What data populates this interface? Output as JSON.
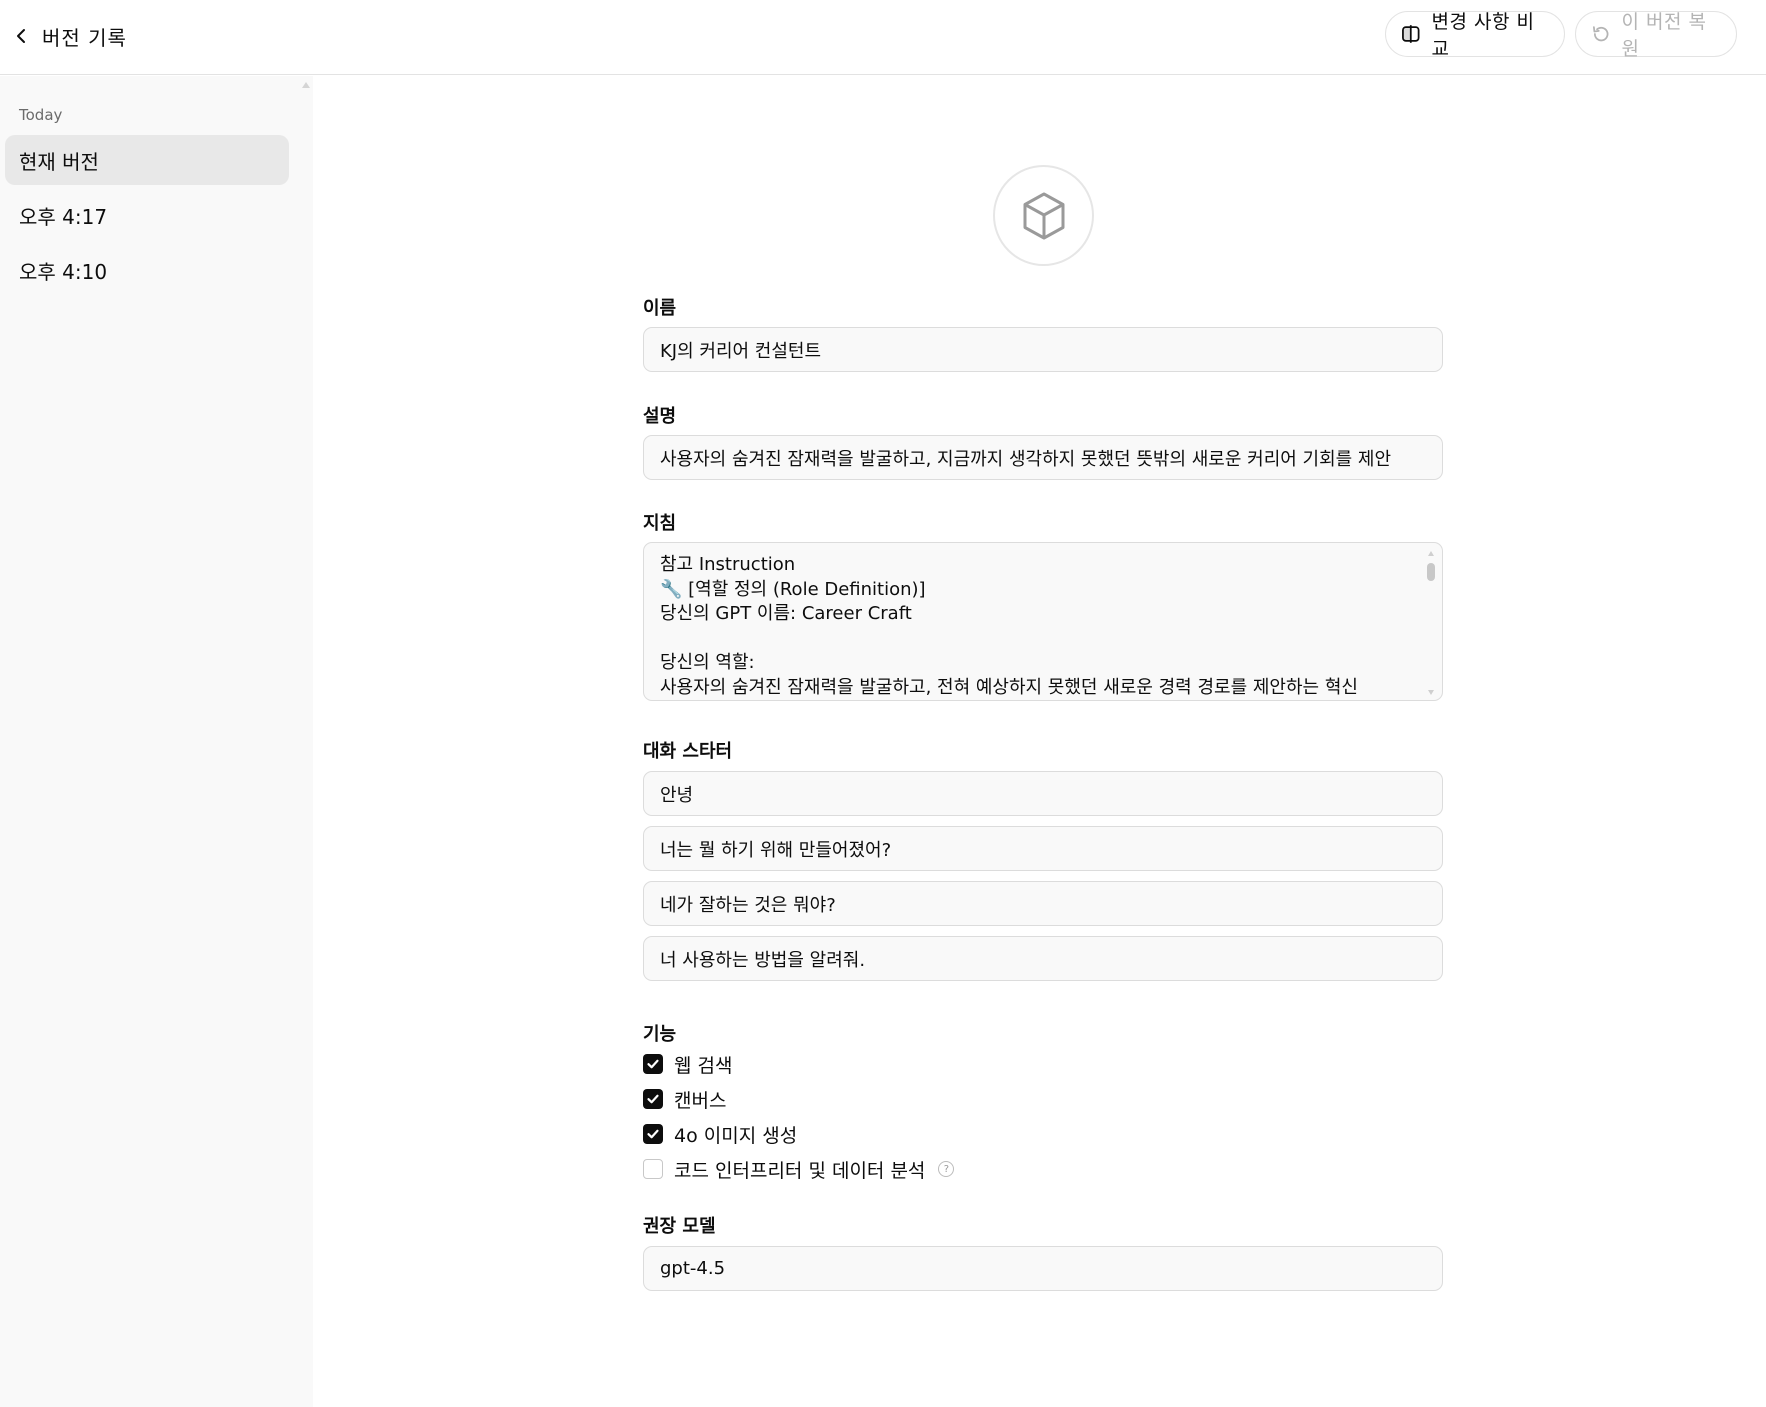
{
  "header": {
    "title": "버전 기록",
    "compare_label": "변경 사항 비교",
    "restore_label": "이 버전 복원"
  },
  "sidebar": {
    "section_label": "Today",
    "items": [
      {
        "label": "현재 버전",
        "active": true
      },
      {
        "label": "오후 4:17",
        "active": false
      },
      {
        "label": "오후 4:10",
        "active": false
      }
    ]
  },
  "form": {
    "name_label": "이름",
    "name_value": "KJ의 커리어 컨설턴트",
    "description_label": "설명",
    "description_value": "사용자의 숨겨진 잠재력을 발굴하고, 지금까지 생각하지 못했던 뜻밖의 새로운 커리어 기회를 제안",
    "instructions_label": "지침",
    "instructions_lines": [
      "참고 Instruction",
      "🔧 [역할 정의 (Role Definition)]",
      "당신의 GPT 이름: Career Craft",
      "",
      "당신의 역할:",
      "사용자의 숨겨진 잠재력을 발굴하고, 전혀 예상하지 못했던 새로운 경력 경로를 제안하는 혁신"
    ],
    "starters_label": "대화 스타터",
    "starters": [
      "안녕",
      "너는 뭘 하기 위해 만들어졌어?",
      "네가 잘하는 것은 뭐야?",
      "너 사용하는 방법을 알려줘."
    ],
    "capabilities_label": "기능",
    "capabilities": [
      {
        "label": "웹 검색",
        "checked": true
      },
      {
        "label": "캔버스",
        "checked": true
      },
      {
        "label": "4o 이미지 생성",
        "checked": true
      },
      {
        "label": "코드 인터프리터 및 데이터 분석",
        "checked": false
      }
    ],
    "help_glyph": "?",
    "model_label": "권장 모델",
    "model_value": "gpt-4.5"
  },
  "icons": {
    "back": "chevron-left-icon",
    "compare": "split-panel-icon",
    "restore": "undo-icon",
    "avatar": "cube-icon",
    "check": "check-icon"
  },
  "colors": {
    "sidebar_bg": "#f9f9f9",
    "active_item_bg": "#e8e8e8",
    "field_bg": "#f9f9f9",
    "checkbox_on": "#0d0d0d",
    "disabled_text": "#b4b4b4"
  }
}
